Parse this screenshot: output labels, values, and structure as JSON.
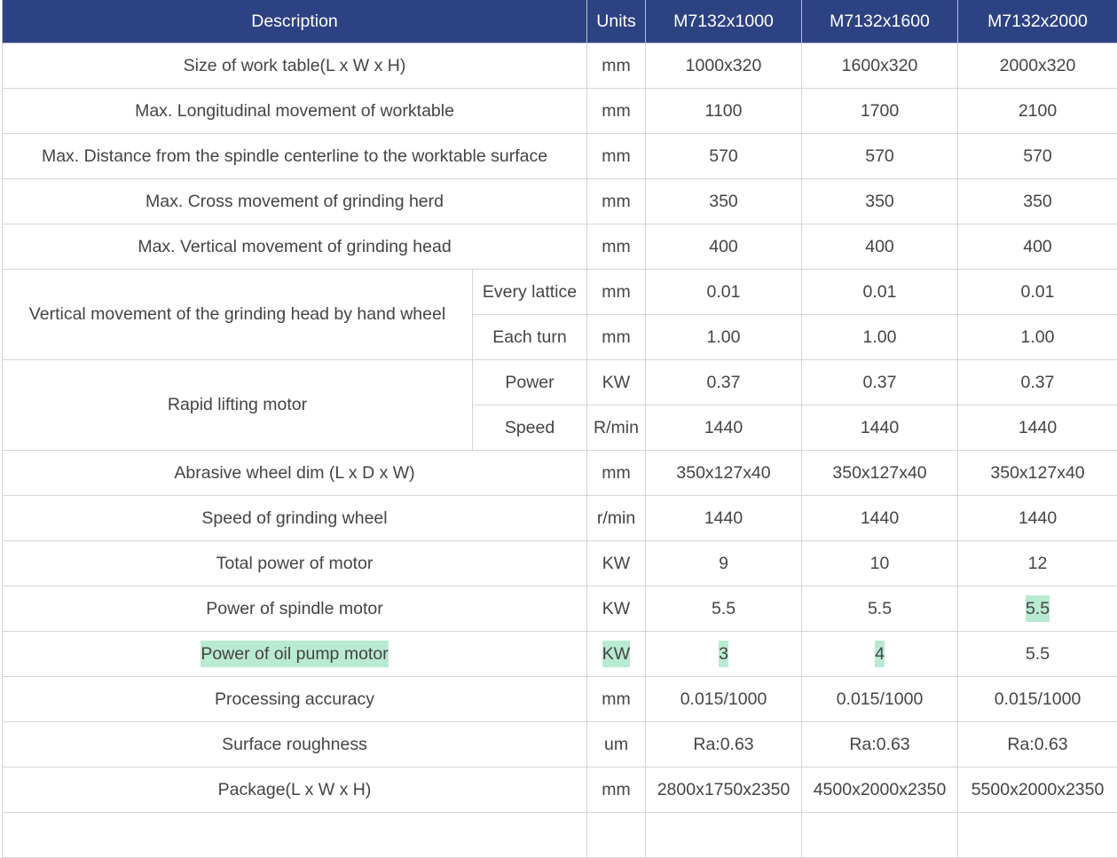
{
  "headers": {
    "description": "Description",
    "units": "Units",
    "models": [
      "M7132x1000",
      "M7132x1600",
      "M7132x2000"
    ]
  },
  "rows": [
    {
      "desc": "Size of work table(L x W x H)",
      "unit": "mm",
      "values": [
        "1000x320",
        "1600x320",
        "2000x320"
      ]
    },
    {
      "desc": "Max. Longitudinal movement of worktable",
      "unit": "mm",
      "values": [
        "1100",
        "1700",
        "2100"
      ]
    },
    {
      "desc": "Max. Distance from the spindle centerline to the worktable surface",
      "unit": "mm",
      "values": [
        "570",
        "570",
        "570"
      ]
    },
    {
      "desc": "Max. Cross movement of grinding herd",
      "unit": "mm",
      "values": [
        "350",
        "350",
        "350"
      ]
    },
    {
      "desc": "Max. Vertical movement of grinding head",
      "unit": "mm",
      "values": [
        "400",
        "400",
        "400"
      ]
    },
    {
      "desc": "Vertical movement of the grinding head by hand wheel",
      "subrows": [
        {
          "sub": "Every lattice",
          "unit": "mm",
          "values": [
            "0.01",
            "0.01",
            "0.01"
          ]
        },
        {
          "sub": "Each turn",
          "unit": "mm",
          "values": [
            "1.00",
            "1.00",
            "1.00"
          ]
        }
      ]
    },
    {
      "desc": "Rapid lifting motor",
      "subrows": [
        {
          "sub": "Power",
          "unit": "KW",
          "values": [
            "0.37",
            "0.37",
            "0.37"
          ]
        },
        {
          "sub": "Speed",
          "unit": "R/min",
          "values": [
            "1440",
            "1440",
            "1440"
          ]
        }
      ]
    },
    {
      "desc": "Abrasive wheel dim (L x D x W)",
      "unit": "mm",
      "values": [
        "350x127x40",
        "350x127x40",
        "350x127x40"
      ]
    },
    {
      "desc": "Speed of grinding wheel",
      "unit": "r/min",
      "values": [
        "1440",
        "1440",
        "1440"
      ]
    },
    {
      "desc": "Total power of motor",
      "unit": "KW",
      "values": [
        "9",
        "10",
        "12"
      ]
    },
    {
      "desc": "Power of spindle motor",
      "unit": "KW",
      "values": [
        "5.5",
        "5.5",
        "5.5"
      ]
    },
    {
      "desc": "Power of oil pump motor",
      "unit": "KW",
      "values": [
        "3",
        "4",
        "5.5"
      ]
    },
    {
      "desc": "Processing accuracy",
      "unit": "mm",
      "values": [
        "0.015/1000",
        "0.015/1000",
        "0.015/1000"
      ]
    },
    {
      "desc": "Surface roughness",
      "unit": "um",
      "values": [
        "Ra:0.63",
        "Ra:0.63",
        "Ra:0.63"
      ]
    },
    {
      "desc": "Package(L x W x H)",
      "unit": "mm",
      "values": [
        "2800x1750x2350",
        "4500x2000x2350",
        "5500x2000x2350"
      ]
    }
  ],
  "highlight_color": "#b9ead2",
  "header_color": "#2d4283"
}
